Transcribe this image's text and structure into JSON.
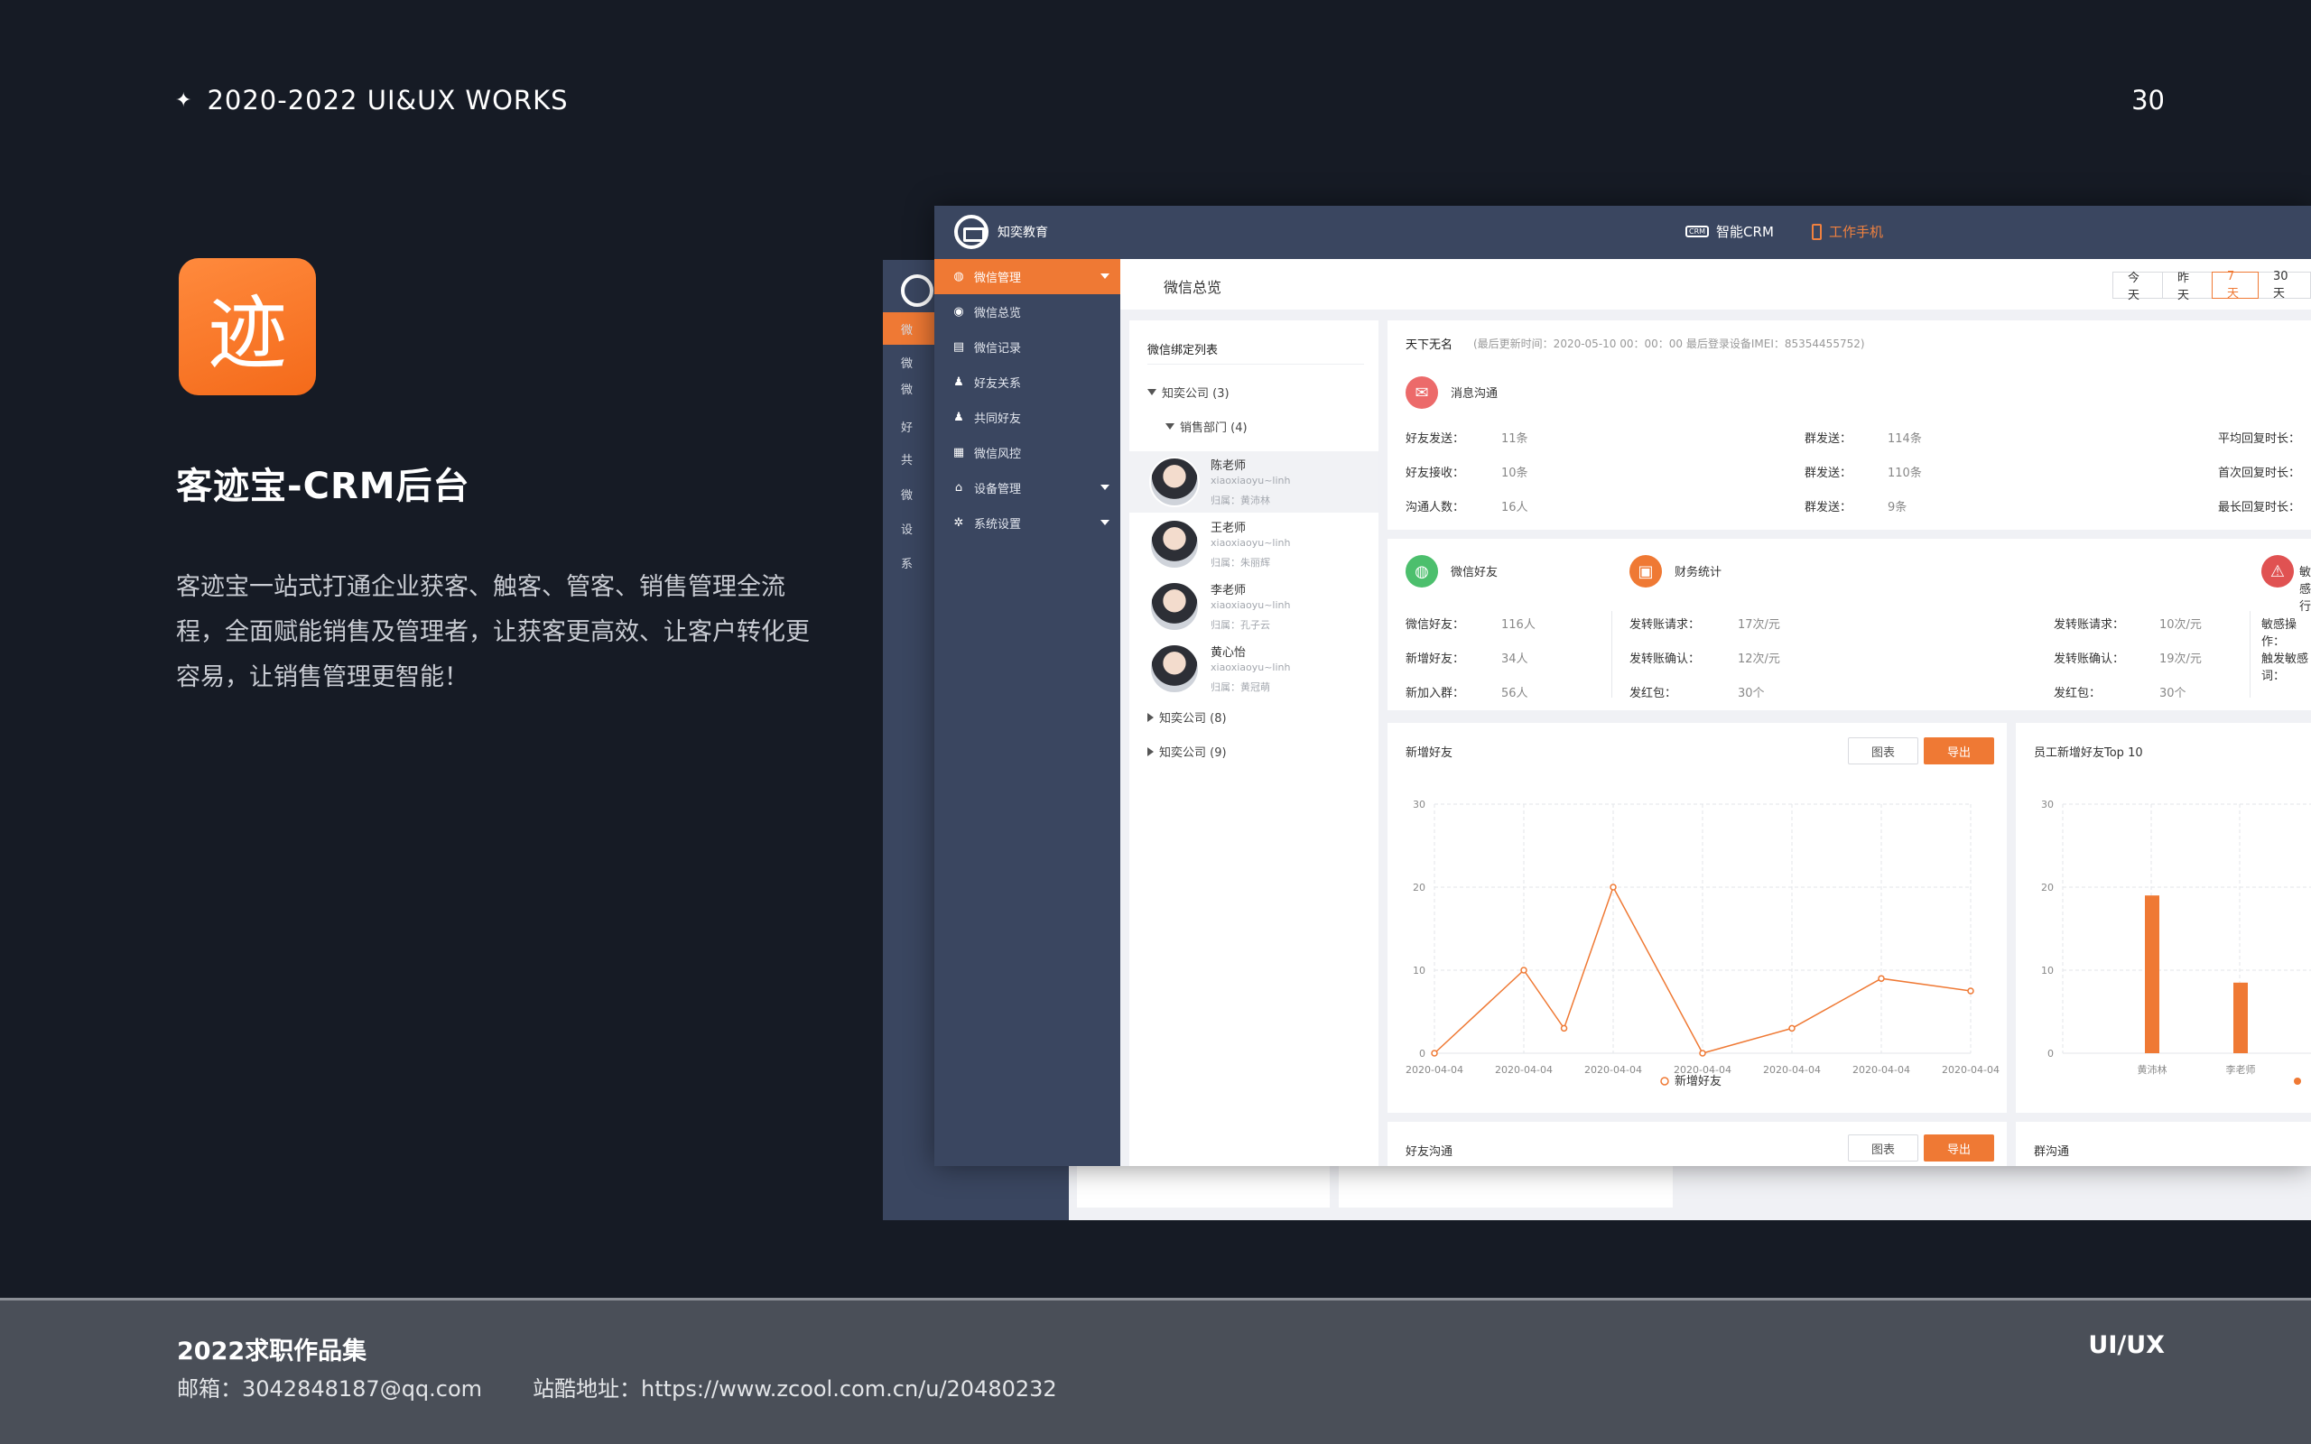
{
  "page": {
    "header_text": "2020-2022  UI&UX  WORKS",
    "page_number": "30",
    "app_icon_char": "迹",
    "project_title": "客迹宝-CRM后台",
    "project_desc": "客迹宝一站式打通企业获客、触客、管客、销售管理全流程，全面赋能销售及管理者，让获客更高效、让客户转化更容易，让销售管理更智能！",
    "footer_title": "2022求职作品集",
    "footer_email": "邮箱：3042848187@qq.com",
    "footer_site": "站酷地址：https://www.zcool.com.cn/u/20480232",
    "footer_right": "UI/UX"
  },
  "app": {
    "brand": "知奕教育",
    "nav_crm": "智能CRM",
    "nav_phone": "工作手机",
    "accent": "#ef7934",
    "sidebar": [
      {
        "label": "微信管理",
        "icon": "wechat-icon",
        "active": true,
        "caret": true
      },
      {
        "label": "微信总览",
        "icon": "eye-icon"
      },
      {
        "label": "微信记录",
        "icon": "document-icon"
      },
      {
        "label": "好友关系",
        "icon": "user-icon"
      },
      {
        "label": "共同好友",
        "icon": "users-icon"
      },
      {
        "label": "微信风控",
        "icon": "shield-doc-icon"
      },
      {
        "label": "设备管理",
        "icon": "device-icon",
        "caret": true
      },
      {
        "label": "系统设置",
        "icon": "gear-icon",
        "caret": true
      }
    ],
    "back_sidebar": [
      "微",
      "微",
      "微",
      "好",
      "共",
      "微",
      "设",
      "系"
    ],
    "page_title": "微信总览",
    "ranges": [
      "今天",
      "昨天",
      "7天",
      "30天"
    ],
    "active_range": "7天",
    "tree": {
      "title": "微信绑定列表",
      "company1": "知奕公司 (3)",
      "dept": "销售部门 (4)",
      "people": [
        {
          "name": "陈老师",
          "account": "xiaoxiaoyu~linh",
          "owner": "归属：黄沛林"
        },
        {
          "name": "王老师",
          "account": "xiaoxiaoyu~linh",
          "owner": "归属：朱丽辉"
        },
        {
          "name": "李老师",
          "account": "xiaoxiaoyu~linh",
          "owner": "归属：孔子云"
        },
        {
          "name": "黄心怡",
          "account": "xiaoxiaoyu~linh",
          "owner": "归属：黄冠萌"
        }
      ],
      "company2": "知奕公司 (8)",
      "company3": "知奕公司 (9)"
    },
    "info": {
      "name": "天下无名",
      "meta": "(最后更新时间：2020-05-10 00：00：00  最后登录设备IMEI：85354455752)",
      "section": "消息沟通",
      "rows": [
        [
          "好友发送：",
          "11条",
          "群发送：",
          "114条",
          "平均回复时长："
        ],
        [
          "好友接收：",
          "10条",
          "群发送：",
          "110条",
          "首次回复时长："
        ],
        [
          "沟通人数：",
          "16人",
          "群发送：",
          "9条",
          "最长回复时长："
        ]
      ]
    },
    "stats": {
      "friends_title": "微信好友",
      "finance_title": "财务统计",
      "sensitive_title": "敏感行",
      "friends": [
        [
          "微信好友：",
          "116人"
        ],
        [
          "新增好友：",
          "34人"
        ],
        [
          "新加入群：",
          "56人"
        ]
      ],
      "finance_a": [
        [
          "发转账请求：",
          "17次/元"
        ],
        [
          "发转账确认：",
          "12次/元"
        ],
        [
          "发红包：",
          "30个"
        ]
      ],
      "finance_b": [
        [
          "发转账请求：",
          "10次/元"
        ],
        [
          "发转账确认：",
          "19次/元"
        ],
        [
          "发红包：",
          "30个"
        ]
      ],
      "sensitive": [
        "敏感操作：",
        "触发敏感词："
      ]
    },
    "chart_panel": {
      "title": "新增好友",
      "btn_chart": "图表",
      "btn_export": "导出",
      "legend": "新增好友"
    },
    "top10_panel": {
      "title": "员工新增好友Top 10"
    },
    "bottom_panel": {
      "title": "好友沟通",
      "btn_chart": "图表",
      "btn_export": "导出",
      "group_title": "群沟通"
    }
  },
  "chart_data": [
    {
      "type": "line",
      "title": "新增好友",
      "x": [
        "2020-04-04",
        "2020-04-04",
        "2020-04-04",
        "2020-04-04",
        "2020-04-04",
        "2020-04-04",
        "2020-04-04"
      ],
      "series": [
        {
          "name": "新增好友",
          "values": [
            0,
            10,
            3,
            20,
            0,
            3,
            9,
            7.5
          ]
        }
      ],
      "point_x_index": [
        0,
        1,
        1.45,
        2,
        3,
        4,
        5,
        6
      ],
      "ylim": [
        0,
        30
      ],
      "yticks": [
        0,
        10,
        20,
        30
      ],
      "grid": true,
      "legend": "bottom-center",
      "color": "#ef7934"
    },
    {
      "type": "bar",
      "title": "员工新增好友Top 10",
      "categories": [
        "黄沛林",
        "李老师"
      ],
      "values": [
        19,
        8.5
      ],
      "ylim": [
        0,
        30
      ],
      "yticks": [
        0,
        10,
        20,
        30
      ],
      "color": "#ef7934"
    }
  ]
}
